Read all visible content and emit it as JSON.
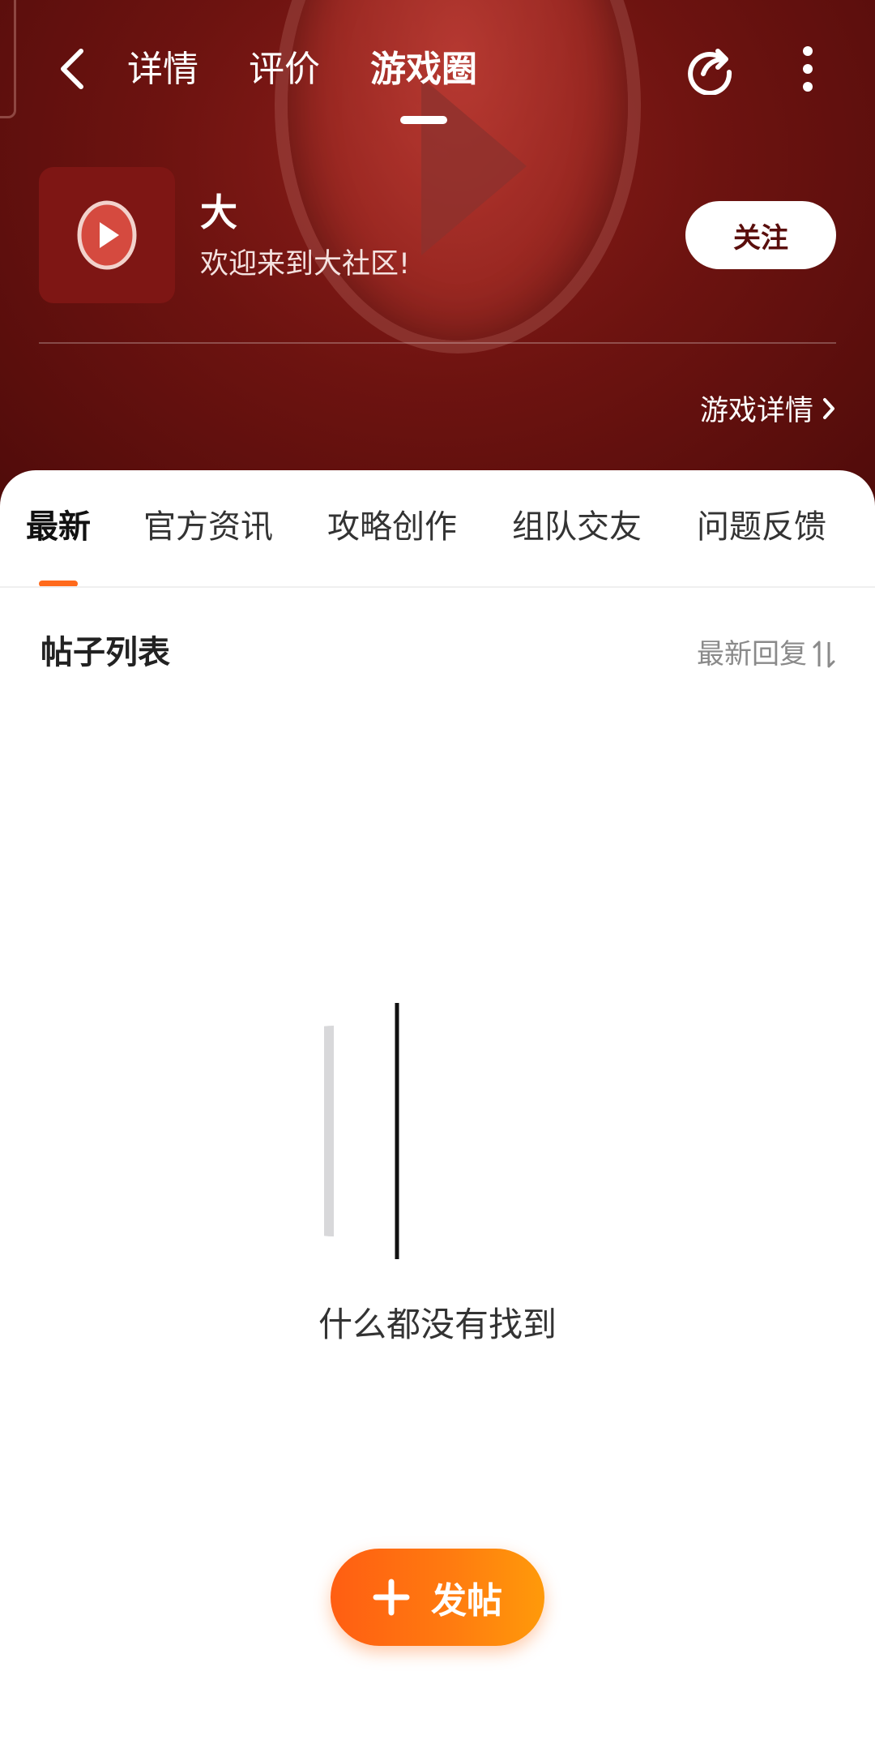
{
  "topbar": {
    "tabs": [
      {
        "label": "详情"
      },
      {
        "label": "评价"
      },
      {
        "label": "游戏圈"
      }
    ],
    "active_tab": "游戏圈"
  },
  "game": {
    "name": "大",
    "welcome": "欢迎来到大社区!",
    "follow_label": "关注",
    "detail_link": "游戏详情"
  },
  "categories": [
    {
      "label": "最新"
    },
    {
      "label": "官方资讯"
    },
    {
      "label": "攻略创作"
    },
    {
      "label": "组队交友"
    },
    {
      "label": "问题反馈"
    }
  ],
  "active_category": "最新",
  "list": {
    "title": "帖子列表",
    "sort_label": "最新回复"
  },
  "empty": {
    "message": "什么都没有找到"
  },
  "post_button": {
    "label": "发帖"
  },
  "colors": {
    "header_red": "#6d1310",
    "accent_orange": "#ff6a1c",
    "post_gradient_start": "#ff5e12",
    "post_gradient_end": "#ff9a0a"
  }
}
